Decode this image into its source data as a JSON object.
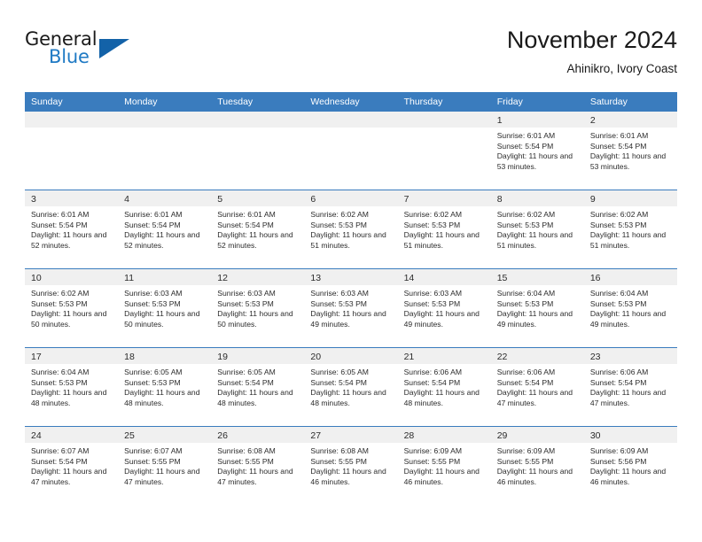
{
  "brand": {
    "name_part1": "General",
    "name_part2": "Blue",
    "logo_icon": "blue-triangle-icon"
  },
  "header": {
    "title": "November 2024",
    "subtitle": "Ahinikro, Ivory Coast"
  },
  "colors": {
    "header_blue": "#3a7cbe",
    "brand_blue": "#1f7ac4",
    "triangle_blue": "#1362a8",
    "day_band_grey": "#f0f0f0",
    "text": "#2b2b2b"
  },
  "weekday_headers": [
    "Sunday",
    "Monday",
    "Tuesday",
    "Wednesday",
    "Thursday",
    "Friday",
    "Saturday"
  ],
  "weeks": [
    [
      {
        "day": "",
        "empty": true
      },
      {
        "day": "",
        "empty": true
      },
      {
        "day": "",
        "empty": true
      },
      {
        "day": "",
        "empty": true
      },
      {
        "day": "",
        "empty": true
      },
      {
        "day": "1",
        "sunrise": "Sunrise: 6:01 AM",
        "sunset": "Sunset: 5:54 PM",
        "daylight": "Daylight: 11 hours and 53 minutes."
      },
      {
        "day": "2",
        "sunrise": "Sunrise: 6:01 AM",
        "sunset": "Sunset: 5:54 PM",
        "daylight": "Daylight: 11 hours and 53 minutes."
      }
    ],
    [
      {
        "day": "3",
        "sunrise": "Sunrise: 6:01 AM",
        "sunset": "Sunset: 5:54 PM",
        "daylight": "Daylight: 11 hours and 52 minutes."
      },
      {
        "day": "4",
        "sunrise": "Sunrise: 6:01 AM",
        "sunset": "Sunset: 5:54 PM",
        "daylight": "Daylight: 11 hours and 52 minutes."
      },
      {
        "day": "5",
        "sunrise": "Sunrise: 6:01 AM",
        "sunset": "Sunset: 5:54 PM",
        "daylight": "Daylight: 11 hours and 52 minutes."
      },
      {
        "day": "6",
        "sunrise": "Sunrise: 6:02 AM",
        "sunset": "Sunset: 5:53 PM",
        "daylight": "Daylight: 11 hours and 51 minutes."
      },
      {
        "day": "7",
        "sunrise": "Sunrise: 6:02 AM",
        "sunset": "Sunset: 5:53 PM",
        "daylight": "Daylight: 11 hours and 51 minutes."
      },
      {
        "day": "8",
        "sunrise": "Sunrise: 6:02 AM",
        "sunset": "Sunset: 5:53 PM",
        "daylight": "Daylight: 11 hours and 51 minutes."
      },
      {
        "day": "9",
        "sunrise": "Sunrise: 6:02 AM",
        "sunset": "Sunset: 5:53 PM",
        "daylight": "Daylight: 11 hours and 51 minutes."
      }
    ],
    [
      {
        "day": "10",
        "sunrise": "Sunrise: 6:02 AM",
        "sunset": "Sunset: 5:53 PM",
        "daylight": "Daylight: 11 hours and 50 minutes."
      },
      {
        "day": "11",
        "sunrise": "Sunrise: 6:03 AM",
        "sunset": "Sunset: 5:53 PM",
        "daylight": "Daylight: 11 hours and 50 minutes."
      },
      {
        "day": "12",
        "sunrise": "Sunrise: 6:03 AM",
        "sunset": "Sunset: 5:53 PM",
        "daylight": "Daylight: 11 hours and 50 minutes."
      },
      {
        "day": "13",
        "sunrise": "Sunrise: 6:03 AM",
        "sunset": "Sunset: 5:53 PM",
        "daylight": "Daylight: 11 hours and 49 minutes."
      },
      {
        "day": "14",
        "sunrise": "Sunrise: 6:03 AM",
        "sunset": "Sunset: 5:53 PM",
        "daylight": "Daylight: 11 hours and 49 minutes."
      },
      {
        "day": "15",
        "sunrise": "Sunrise: 6:04 AM",
        "sunset": "Sunset: 5:53 PM",
        "daylight": "Daylight: 11 hours and 49 minutes."
      },
      {
        "day": "16",
        "sunrise": "Sunrise: 6:04 AM",
        "sunset": "Sunset: 5:53 PM",
        "daylight": "Daylight: 11 hours and 49 minutes."
      }
    ],
    [
      {
        "day": "17",
        "sunrise": "Sunrise: 6:04 AM",
        "sunset": "Sunset: 5:53 PM",
        "daylight": "Daylight: 11 hours and 48 minutes."
      },
      {
        "day": "18",
        "sunrise": "Sunrise: 6:05 AM",
        "sunset": "Sunset: 5:53 PM",
        "daylight": "Daylight: 11 hours and 48 minutes."
      },
      {
        "day": "19",
        "sunrise": "Sunrise: 6:05 AM",
        "sunset": "Sunset: 5:54 PM",
        "daylight": "Daylight: 11 hours and 48 minutes."
      },
      {
        "day": "20",
        "sunrise": "Sunrise: 6:05 AM",
        "sunset": "Sunset: 5:54 PM",
        "daylight": "Daylight: 11 hours and 48 minutes."
      },
      {
        "day": "21",
        "sunrise": "Sunrise: 6:06 AM",
        "sunset": "Sunset: 5:54 PM",
        "daylight": "Daylight: 11 hours and 48 minutes."
      },
      {
        "day": "22",
        "sunrise": "Sunrise: 6:06 AM",
        "sunset": "Sunset: 5:54 PM",
        "daylight": "Daylight: 11 hours and 47 minutes."
      },
      {
        "day": "23",
        "sunrise": "Sunrise: 6:06 AM",
        "sunset": "Sunset: 5:54 PM",
        "daylight": "Daylight: 11 hours and 47 minutes."
      }
    ],
    [
      {
        "day": "24",
        "sunrise": "Sunrise: 6:07 AM",
        "sunset": "Sunset: 5:54 PM",
        "daylight": "Daylight: 11 hours and 47 minutes."
      },
      {
        "day": "25",
        "sunrise": "Sunrise: 6:07 AM",
        "sunset": "Sunset: 5:55 PM",
        "daylight": "Daylight: 11 hours and 47 minutes."
      },
      {
        "day": "26",
        "sunrise": "Sunrise: 6:08 AM",
        "sunset": "Sunset: 5:55 PM",
        "daylight": "Daylight: 11 hours and 47 minutes."
      },
      {
        "day": "27",
        "sunrise": "Sunrise: 6:08 AM",
        "sunset": "Sunset: 5:55 PM",
        "daylight": "Daylight: 11 hours and 46 minutes."
      },
      {
        "day": "28",
        "sunrise": "Sunrise: 6:09 AM",
        "sunset": "Sunset: 5:55 PM",
        "daylight": "Daylight: 11 hours and 46 minutes."
      },
      {
        "day": "29",
        "sunrise": "Sunrise: 6:09 AM",
        "sunset": "Sunset: 5:55 PM",
        "daylight": "Daylight: 11 hours and 46 minutes."
      },
      {
        "day": "30",
        "sunrise": "Sunrise: 6:09 AM",
        "sunset": "Sunset: 5:56 PM",
        "daylight": "Daylight: 11 hours and 46 minutes."
      }
    ]
  ]
}
